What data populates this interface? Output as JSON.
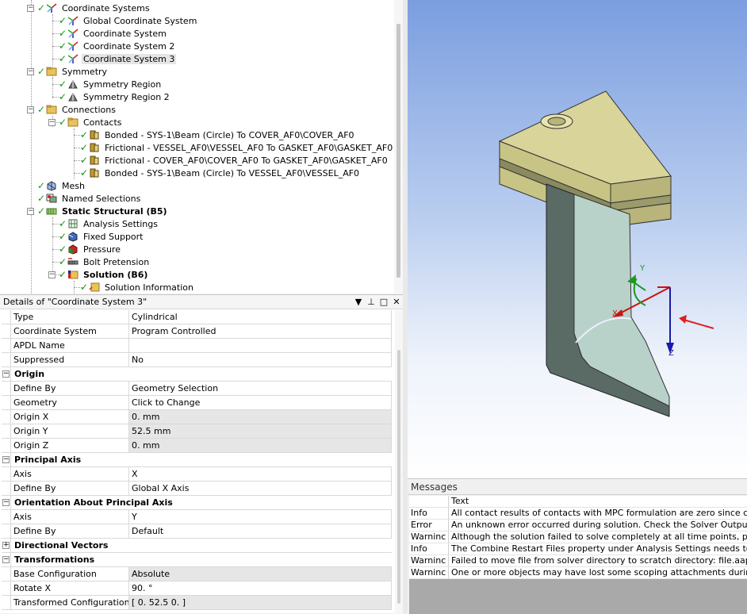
{
  "tree": {
    "items": [
      {
        "label": "Coordinate Systems",
        "level": 0,
        "icon": "coordinate-systems-icon",
        "exp": "−"
      },
      {
        "label": "Global Coordinate System",
        "level": 1,
        "icon": "coordinate-axis-icon"
      },
      {
        "label": "Coordinate System",
        "level": 1,
        "icon": "coordinate-axis-icon"
      },
      {
        "label": "Coordinate System 2",
        "level": 1,
        "icon": "coordinate-axis-icon"
      },
      {
        "label": "Coordinate System 3",
        "level": 1,
        "icon": "coordinate-axis-icon",
        "selected": true
      },
      {
        "label": "Symmetry",
        "level": 0,
        "icon": "folder-icon",
        "exp": "−"
      },
      {
        "label": "Symmetry Region",
        "level": 1,
        "icon": "symmetry-icon"
      },
      {
        "label": "Symmetry Region 2",
        "level": 1,
        "icon": "symmetry-icon"
      },
      {
        "label": "Connections",
        "level": 0,
        "icon": "folder-icon",
        "exp": "−"
      },
      {
        "label": "Contacts",
        "level": 1,
        "icon": "folder-icon",
        "exp": "−"
      },
      {
        "label": "Bonded - SYS-1\\Beam (Circle) To COVER_AF0\\COVER_AF0",
        "level": 2,
        "icon": "contact-icon"
      },
      {
        "label": "Frictional - VESSEL_AF0\\VESSEL_AF0 To GASKET_AF0\\GASKET_AF0",
        "level": 2,
        "icon": "contact-icon"
      },
      {
        "label": "Frictional - COVER_AF0\\COVER_AF0 To GASKET_AF0\\GASKET_AF0",
        "level": 2,
        "icon": "contact-icon"
      },
      {
        "label": "Bonded - SYS-1\\Beam (Circle) To VESSEL_AF0\\VESSEL_AF0",
        "level": 2,
        "icon": "contact-icon"
      },
      {
        "label": "Mesh",
        "level": 0,
        "icon": "mesh-icon"
      },
      {
        "label": "Named Selections",
        "level": 0,
        "icon": "named-selections-icon"
      },
      {
        "label": "Static Structural (B5)",
        "level": 0,
        "icon": "static-structural-icon",
        "bold": true,
        "exp": "−"
      },
      {
        "label": "Analysis Settings",
        "level": 1,
        "icon": "analysis-settings-icon"
      },
      {
        "label": "Fixed Support",
        "level": 1,
        "icon": "fixed-support-icon"
      },
      {
        "label": "Pressure",
        "level": 1,
        "icon": "pressure-icon"
      },
      {
        "label": "Bolt Pretension",
        "level": 1,
        "icon": "bolt-pretension-icon"
      },
      {
        "label": "Solution (B6)",
        "level": 1,
        "icon": "solution-icon",
        "bold": true,
        "exp": "−"
      },
      {
        "label": "Solution Information",
        "level": 2,
        "icon": "solution-information-icon"
      }
    ]
  },
  "details": {
    "title": "Details of \"Coordinate System 3\"",
    "controls": {
      "dropdown": "▼",
      "pin": "⊥",
      "restore": "□",
      "close": "✕"
    },
    "rows": [
      {
        "kind": "row",
        "key": "Type",
        "value": "Cylindrical"
      },
      {
        "kind": "row",
        "key": "Coordinate System",
        "value": "Program Controlled"
      },
      {
        "kind": "row",
        "key": "APDL Name",
        "value": ""
      },
      {
        "kind": "row",
        "key": "Suppressed",
        "value": "No"
      },
      {
        "kind": "group",
        "key": "Origin",
        "exp": "−"
      },
      {
        "kind": "row",
        "key": "Define By",
        "value": "Geometry Selection"
      },
      {
        "kind": "row",
        "key": "Geometry",
        "value": "Click to Change"
      },
      {
        "kind": "row",
        "key": "Origin X",
        "value": "0. mm",
        "gray": true
      },
      {
        "kind": "row",
        "key": "Origin Y",
        "value": "52.5 mm",
        "gray": true
      },
      {
        "kind": "row",
        "key": "Origin Z",
        "value": "0. mm",
        "gray": true
      },
      {
        "kind": "group",
        "key": "Principal Axis",
        "exp": "−"
      },
      {
        "kind": "row",
        "key": "Axis",
        "value": "X"
      },
      {
        "kind": "row",
        "key": "Define By",
        "value": "Global X Axis"
      },
      {
        "kind": "group",
        "key": "Orientation About Principal Axis",
        "exp": "−"
      },
      {
        "kind": "row",
        "key": "Axis",
        "value": "Y"
      },
      {
        "kind": "row",
        "key": "Define By",
        "value": "Default"
      },
      {
        "kind": "group",
        "key": "Directional Vectors",
        "exp": "+"
      },
      {
        "kind": "group",
        "key": "Transformations",
        "exp": "−"
      },
      {
        "kind": "row",
        "key": "Base Configuration",
        "value": "Absolute",
        "gray": true
      },
      {
        "kind": "row",
        "key": "Rotate X",
        "value": "90. °"
      },
      {
        "kind": "row",
        "key": "Transformed Configuration",
        "value": "[ 0.  52.5  0. ]",
        "gray": true
      }
    ]
  },
  "viewport": {
    "axis_labels": {
      "x": "X",
      "y": "Y",
      "z": "Z"
    }
  },
  "messages": {
    "title": "Messages",
    "column_header": "Text",
    "rows": [
      {
        "type": "Info",
        "text": "All contact results of contacts with MPC formulation are zero since constr"
      },
      {
        "type": "Error",
        "text": "An unknown error occurred during solution.  Check the Solver Output or"
      },
      {
        "type": "Warninc",
        "text": "Although the solution failed to solve completely at all time points, partia"
      },
      {
        "type": "Info",
        "text": "The Combine Restart Files property under Analysis Settings needs to be s"
      },
      {
        "type": "Warninc",
        "text": "Failed to move file from solver directory to scratch directory: file.aapresult"
      },
      {
        "type": "Warninc",
        "text": "One or more objects may have lost some scoping attachments during the"
      }
    ]
  },
  "colors": {
    "check": "#1f9a1f",
    "selection": "#e5e5e5",
    "gasket_face": "#d8d49a",
    "vessel_face": "#5a6b65",
    "inner_face": "#b8d2c9",
    "axis_x": "#cc1111",
    "axis_y": "#1a9a1a",
    "axis_z": "#1a1aaa",
    "arrow": "#e02020"
  }
}
